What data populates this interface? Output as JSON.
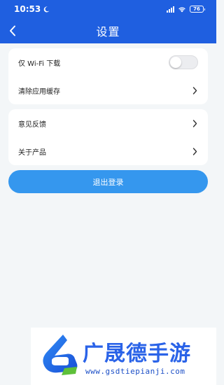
{
  "status_bar": {
    "time": "10:53",
    "battery": "76"
  },
  "header": {
    "title": "设置"
  },
  "settings": {
    "group1": [
      {
        "label": "仅 Wi-Fi 下载",
        "control": "toggle",
        "toggle_on": false
      },
      {
        "label": "清除应用缓存",
        "control": "chevron"
      }
    ],
    "group2": [
      {
        "label": "意见反馈",
        "control": "chevron"
      },
      {
        "label": "关于产品",
        "control": "chevron"
      }
    ]
  },
  "logout_label": "退出登录",
  "watermark": {
    "name": "广晟德手游",
    "url": "www.gsdtiepianji.com"
  },
  "colors": {
    "header_bg": "#1f5fe0",
    "page_bg": "#f3f6f8",
    "button_bg": "#3597ee",
    "watermark_blue": "#2a63e8"
  }
}
